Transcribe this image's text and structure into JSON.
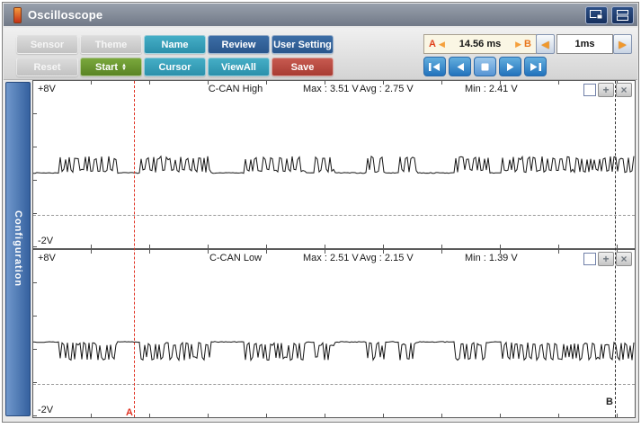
{
  "window": {
    "title": "Oscilloscope"
  },
  "icons": {
    "arrow_left": "◀",
    "arrow_right": "▶",
    "spinner_up": "▲",
    "spinner_down": "▼",
    "plus": "+",
    "close": "×"
  },
  "colors": {
    "teal": "#2e9ab2",
    "navy": "#2d5f92",
    "green": "#648c2a",
    "red": "#b6473f",
    "playback_blue": "#2b7fc2",
    "cursor_a": "#e03020",
    "cursor_b": "#303030",
    "sidebar_blue": "#3a68a8",
    "readout_bg": "#faf6e4"
  },
  "toolbar": {
    "buttons_row1": [
      {
        "label": "Sensor",
        "variant": "disabled"
      },
      {
        "label": "Theme",
        "variant": "disabled"
      },
      {
        "label": "Name",
        "variant": "teal"
      },
      {
        "label": "Review",
        "variant": "navy"
      },
      {
        "label": "User Setting",
        "variant": "navy"
      }
    ],
    "buttons_row2": [
      {
        "label": "Reset",
        "variant": "disabled"
      },
      {
        "label": "Start",
        "variant": "green",
        "has_spinner": true
      },
      {
        "label": "Cursor",
        "variant": "teal"
      },
      {
        "label": "ViewAll",
        "variant": "teal"
      },
      {
        "label": "Save",
        "variant": "red"
      }
    ],
    "cursor_readout": {
      "a_label": "A",
      "b_label": "B",
      "value": "14.56 ms"
    },
    "timebase": {
      "value": "1ms"
    }
  },
  "sidebar": {
    "tab_label": "Configuration"
  },
  "cursors": {
    "a": {
      "label": "A",
      "x_frac": 0.167,
      "color": "#e03020"
    },
    "b": {
      "label": "B",
      "x_frac": 0.967,
      "color": "#303030"
    }
  },
  "chart_data": [
    {
      "type": "line",
      "title": "C-CAN High",
      "ylabel_top": "+8V",
      "ylabel_bottom": "-2V",
      "y_range_v": [
        -2,
        8
      ],
      "grid_v": 0,
      "baseline_v": 2.5,
      "dominant_v": 3.5,
      "polarity": "up",
      "stats": {
        "max_label": "Max : 3.51 V",
        "avg_label": "Avg : 2.75 V",
        "min_label": "Min : 2.41 V",
        "max_v": 3.51,
        "avg_v": 2.75,
        "min_v": 2.41
      },
      "bursts_frac": [
        [
          0.043,
          0.14
        ],
        [
          0.178,
          0.293
        ],
        [
          0.35,
          0.454
        ],
        [
          0.469,
          0.502
        ],
        [
          0.556,
          0.583
        ],
        [
          0.607,
          0.637
        ],
        [
          0.701,
          0.758
        ],
        [
          0.779,
          1.0
        ]
      ],
      "seed": 7
    },
    {
      "type": "line",
      "title": "C-CAN Low",
      "ylabel_top": "+8V",
      "ylabel_bottom": "-2V",
      "y_range_v": [
        -2,
        8
      ],
      "grid_v": 0,
      "baseline_v": 2.5,
      "dominant_v": 1.4,
      "polarity": "down",
      "stats": {
        "max_label": "Max : 2.51 V",
        "avg_label": "Avg : 2.15 V",
        "min_label": "Min : 1.39 V",
        "max_v": 2.51,
        "avg_v": 2.15,
        "min_v": 1.39
      },
      "bursts_frac": [
        [
          0.043,
          0.14
        ],
        [
          0.178,
          0.293
        ],
        [
          0.35,
          0.454
        ],
        [
          0.469,
          0.502
        ],
        [
          0.556,
          0.583
        ],
        [
          0.607,
          0.637
        ],
        [
          0.701,
          0.758
        ],
        [
          0.779,
          1.0
        ]
      ],
      "seed": 13
    }
  ]
}
